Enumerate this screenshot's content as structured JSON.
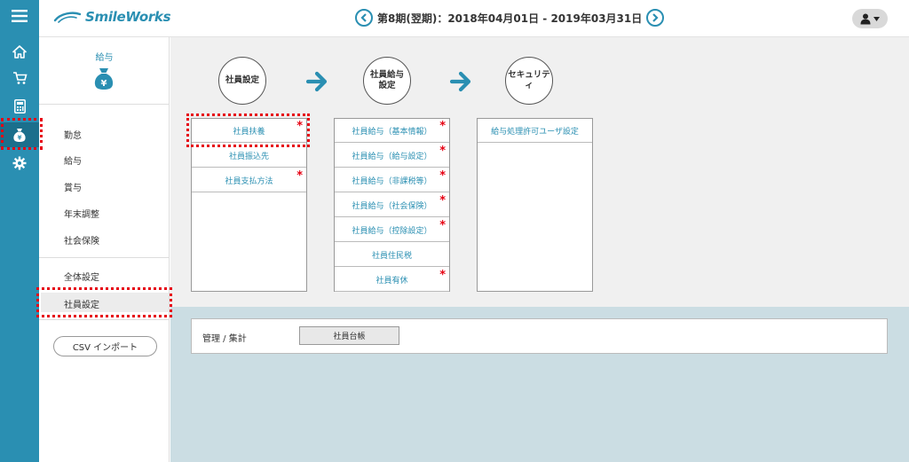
{
  "app": {
    "logo_text": "SmileWorks"
  },
  "header": {
    "period_text": "第8期(翌期)：2018年04月01日 - 2019年03月31日"
  },
  "rail": {
    "items": [
      {
        "name": "menu-icon"
      },
      {
        "name": "home-icon"
      },
      {
        "name": "cart-icon"
      },
      {
        "name": "calculator-icon"
      },
      {
        "name": "money-bag-icon",
        "active": true
      },
      {
        "name": "gear-icon"
      }
    ]
  },
  "side": {
    "category_label": "給与",
    "items": [
      "勤怠",
      "給与",
      "賞与",
      "年末調整",
      "社会保険",
      "全体設定",
      "社員設定"
    ],
    "active_item": "社員設定",
    "csv_button": "CSV インポート"
  },
  "steps": [
    {
      "label_line1": "社員設定",
      "label_line2": ""
    },
    {
      "label_line1": "社員給与",
      "label_line2": "設定"
    },
    {
      "label_line1": "セキュリティ",
      "label_line2": ""
    }
  ],
  "columns": [
    {
      "items": [
        {
          "label": "社員扶養",
          "required": true
        },
        {
          "label": "社員振込先",
          "required": false
        },
        {
          "label": "社員支払方法",
          "required": true
        }
      ]
    },
    {
      "items": [
        {
          "label": "社員給与（基本情報）",
          "required": true
        },
        {
          "label": "社員給与（給与設定）",
          "required": true
        },
        {
          "label": "社員給与（非課税等）",
          "required": true
        },
        {
          "label": "社員給与（社会保険）",
          "required": true
        },
        {
          "label": "社員給与（控除設定）",
          "required": true
        },
        {
          "label": "社員住民税",
          "required": false
        },
        {
          "label": "社員有休",
          "required": true
        }
      ]
    },
    {
      "items": [
        {
          "label": "給与処理許可ユーザ設定",
          "required": false
        }
      ]
    }
  ],
  "required_mark": "*",
  "management": {
    "label": "管理 / 集計",
    "button": "社員台帳"
  },
  "colors": {
    "brand": "#2a8fb2",
    "required": "#e60012",
    "highlight": "#e60012"
  }
}
